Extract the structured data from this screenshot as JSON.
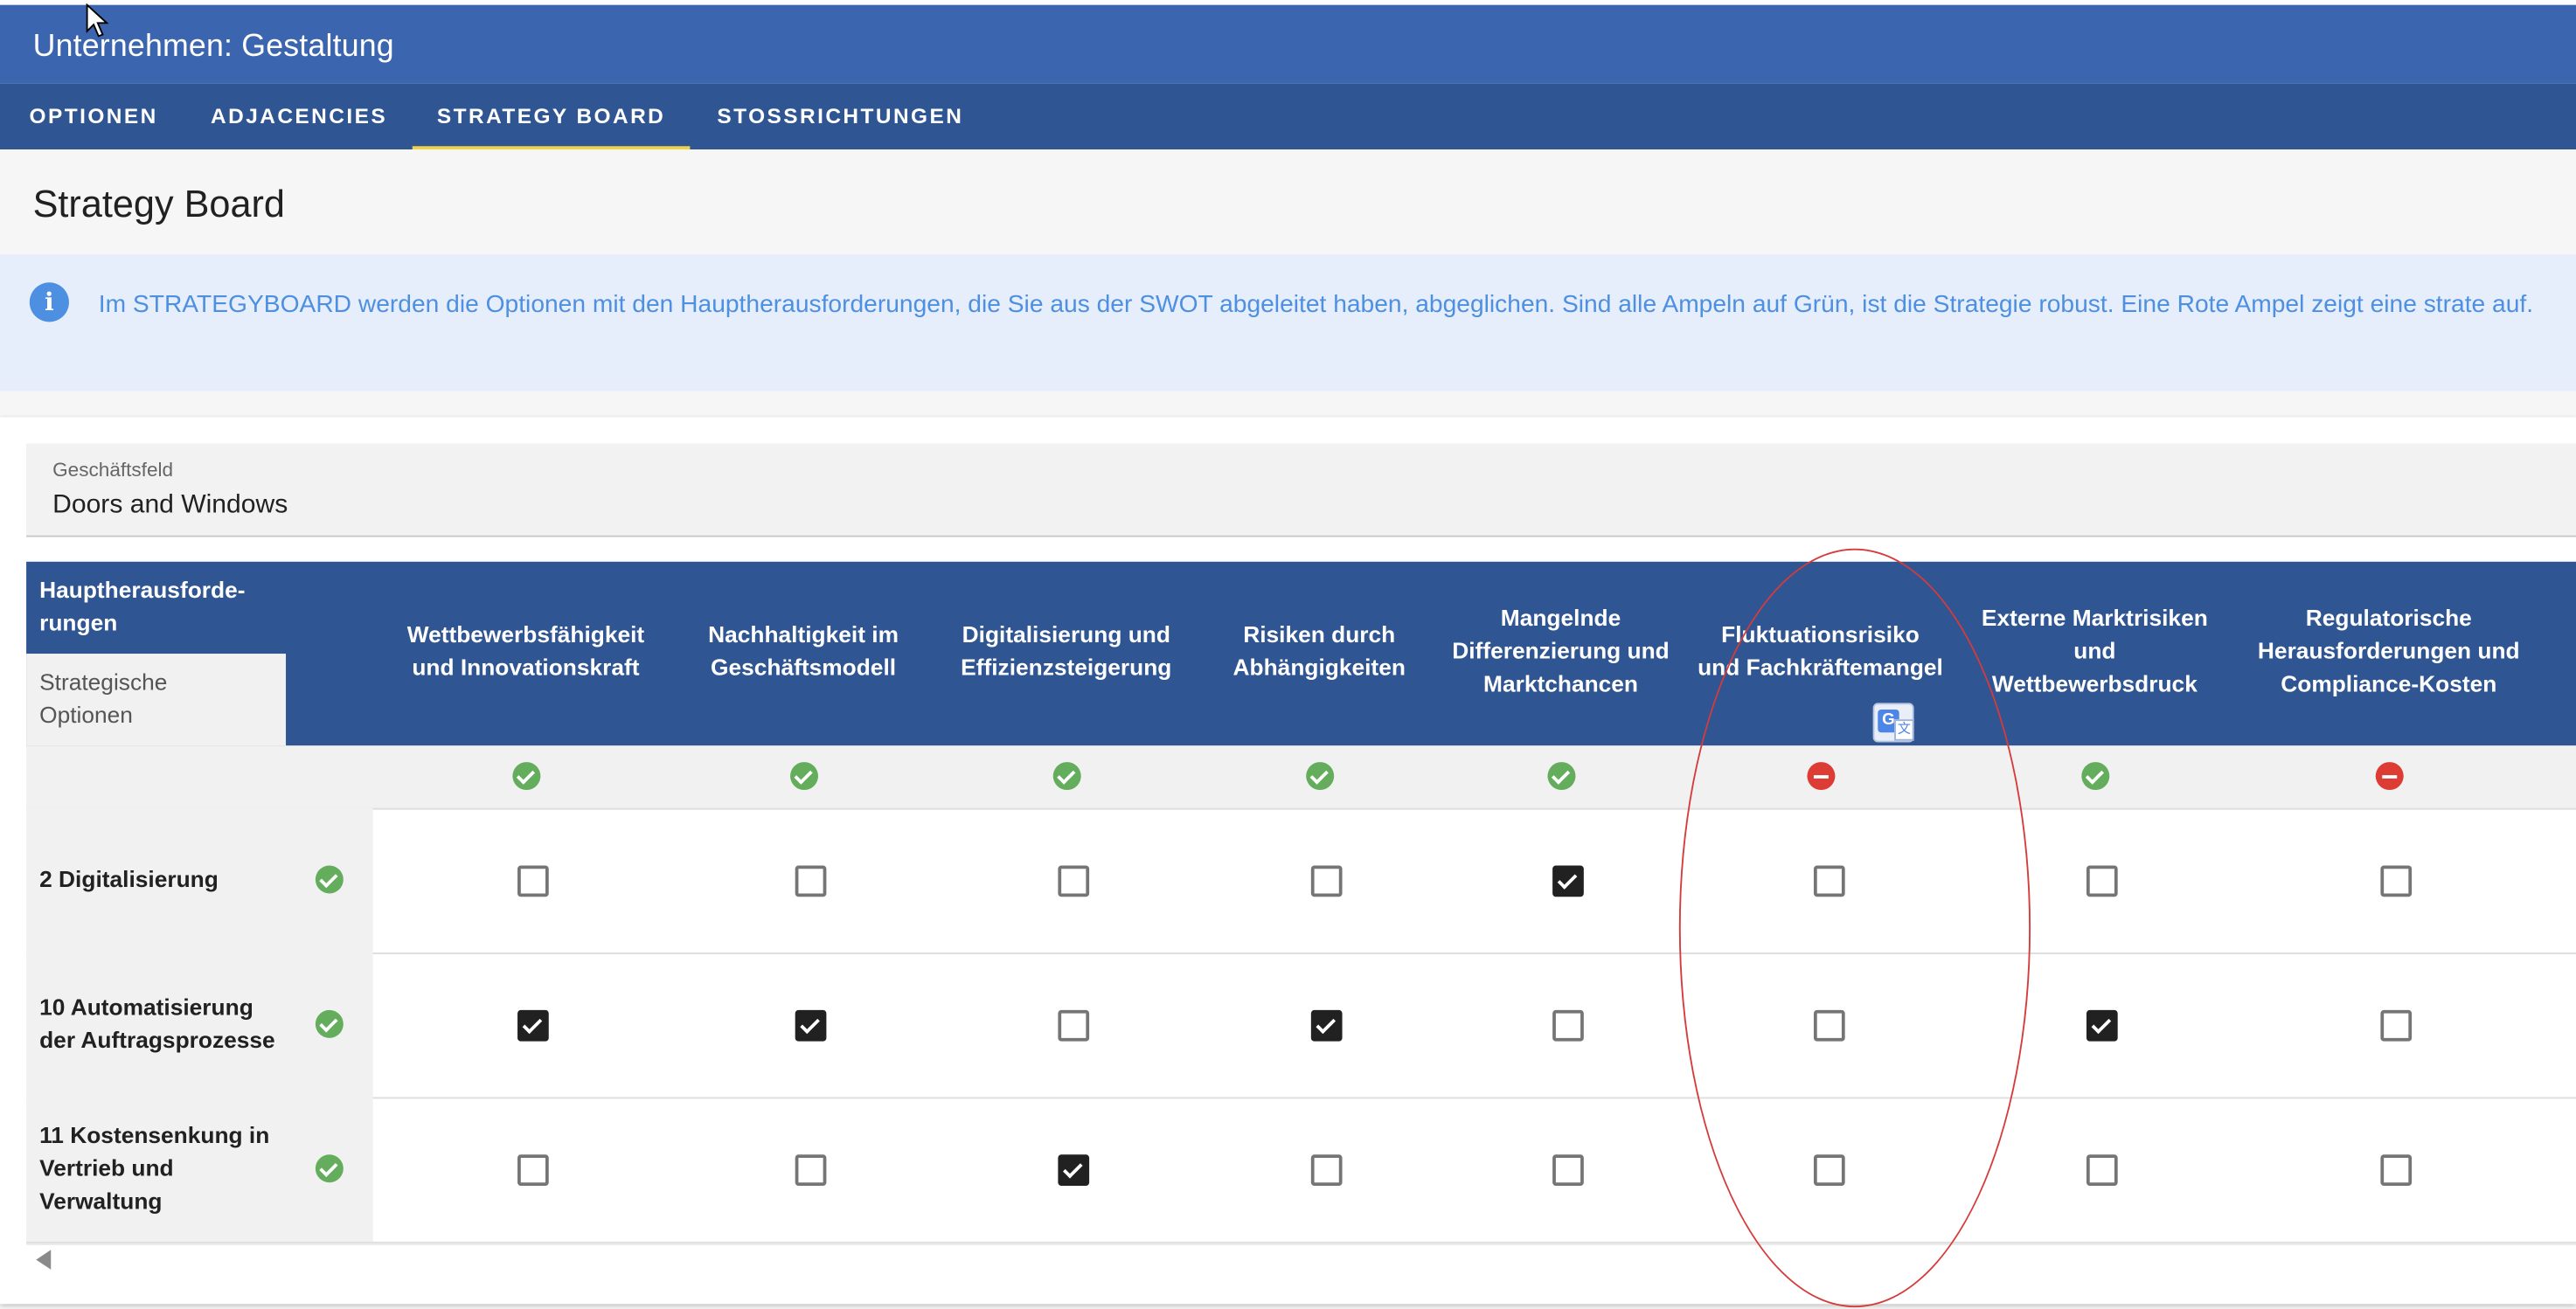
{
  "app": {
    "title": "Unternehmen: Gestaltung"
  },
  "tabs": [
    {
      "label": "OPTIONEN",
      "active": false
    },
    {
      "label": "ADJACENCIES",
      "active": false
    },
    {
      "label": "STRATEGY BOARD",
      "active": true
    },
    {
      "label": "STOSSRICHTUNGEN",
      "active": false
    }
  ],
  "page": {
    "title": "Strategy Board"
  },
  "alert": {
    "icon": "info-icon",
    "text": "Im STRATEGYBOARD werden die Optionen mit den Hauptherausforderungen, die Sie aus der SWOT abgeleitet haben, abgeglichen. Sind alle Ampeln auf Grün, ist die Strategie robust. Eine Rote Ampel zeigt eine strate auf."
  },
  "field": {
    "label": "Geschäftsfeld",
    "value": "Doors and Windows"
  },
  "table": {
    "corner_top": "Hauptherausforde-\nrungen",
    "corner_bottom": "Strategische\nOptionen",
    "columns": [
      {
        "label": "Wettbewerbsfähigkeit und Innovationskraft",
        "status": "ok"
      },
      {
        "label": "Nachhaltigkeit im Geschäftsmodell",
        "status": "ok"
      },
      {
        "label": "Digitalisierung und Effizienzsteigerung",
        "status": "ok"
      },
      {
        "label": "Risiken durch Abhängigkeiten",
        "status": "ok"
      },
      {
        "label": "Mangelnde Differenzierung und Marktchancen",
        "status": "ok"
      },
      {
        "label": "Fluktuationsrisiko und Fachkräftemangel",
        "status": "error"
      },
      {
        "label": "Externe Marktrisiken und Wettbewerbsdruck",
        "status": "ok"
      },
      {
        "label": "Regulatorische Herausforderungen und Compliance-Kosten",
        "status": "error"
      }
    ],
    "rows": [
      {
        "label": "2 Digitalisierung",
        "status": "ok",
        "checks": [
          false,
          false,
          false,
          false,
          true,
          false,
          false,
          false
        ]
      },
      {
        "label": "10 Automatisierung der Auftragsprozesse",
        "status": "ok",
        "checks": [
          true,
          true,
          false,
          true,
          false,
          false,
          true,
          false
        ]
      },
      {
        "label": "11 Kostensenkung in Vertrieb und Verwaltung",
        "status": "ok",
        "checks": [
          false,
          false,
          true,
          false,
          false,
          false,
          false,
          false
        ]
      }
    ]
  },
  "colors": {
    "header": "#3b65ae",
    "tabs": "#2f5592",
    "tab_indicator": "#f2d347",
    "ok": "#63ad5c",
    "error": "#dd3c35",
    "info": "#4d8fe0",
    "annotation": "#d63b3b"
  }
}
